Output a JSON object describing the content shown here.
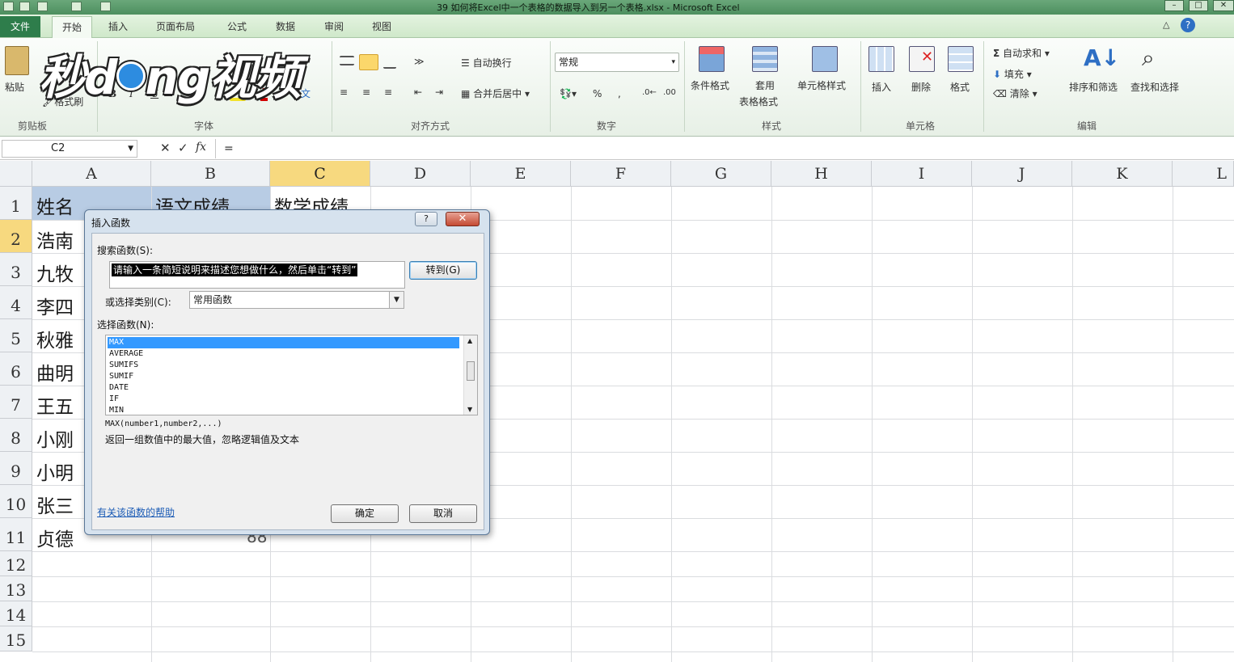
{
  "window": {
    "title": "39 如何将Excel中一个表格的数据导入到另一个表格.xlsx - Microsoft Excel"
  },
  "tabs": {
    "file": "文件",
    "home": "开始",
    "insert": "插入",
    "layout": "页面布局",
    "formula": "公式",
    "data": "数据",
    "review": "审阅",
    "view": "视图"
  },
  "watermark": "秒dong视频",
  "ribbon": {
    "paste": "粘贴",
    "format_painter": "格式刷",
    "clipboard_group": "剪贴板",
    "font_group": "字体",
    "wrap_text": "自动换行",
    "merge_center": "合并后居中",
    "align_group": "对齐方式",
    "number_format": "常规",
    "number_group": "数字",
    "cond_format": "条件格式",
    "table_format_1": "套用",
    "table_format_2": "表格格式",
    "cell_styles": "单元格样式",
    "styles_group": "样式",
    "insert": "插入",
    "delete": "删除",
    "format": "格式",
    "cells_group": "单元格",
    "autosum": "自动求和",
    "fill": "填充",
    "clear": "清除",
    "sort_filter": "排序和筛选",
    "find_select": "查找和选择",
    "edit_group": "编辑"
  },
  "formula_bar": {
    "name_box": "C2",
    "formula": "="
  },
  "columns": [
    "A",
    "B",
    "C",
    "D",
    "E",
    "F",
    "G",
    "H",
    "I",
    "J",
    "K",
    "L"
  ],
  "rows": [
    "1",
    "2",
    "3",
    "4",
    "5",
    "6",
    "7",
    "8",
    "9",
    "10",
    "11",
    "12",
    "13",
    "14",
    "15"
  ],
  "cells": {
    "a1": "姓名",
    "b1": "语文成绩",
    "c1": "数学成绩",
    "a2": "浩南",
    "a3": "九牧",
    "a4": "李四",
    "a5": "秋雅",
    "a6": "曲明",
    "a7": "王五",
    "a8": "小刚",
    "a9": "小明",
    "a10": "张三",
    "a11": "贞德",
    "b11": "88"
  },
  "dialog": {
    "title": "插入函数",
    "help_glyph": "?",
    "close_glyph": "✕",
    "search_label": "搜索函数(S):",
    "search_value": "请输入一条简短说明来描述您想做什么，然后单击“转到”",
    "go_button": "转到(G)",
    "category_label": "或选择类别(C):",
    "category_value": "常用函数",
    "select_label": "选择函数(N):",
    "functions": [
      "MAX",
      "AVERAGE",
      "SUMIFS",
      "SUMIF",
      "DATE",
      "IF",
      "MIN"
    ],
    "signature": "MAX(number1,number2,...)",
    "description": "返回一组数值中的最大值，忽略逻辑值及文本",
    "help_link": "有关该函数的帮助",
    "ok": "确定",
    "cancel": "取消"
  }
}
